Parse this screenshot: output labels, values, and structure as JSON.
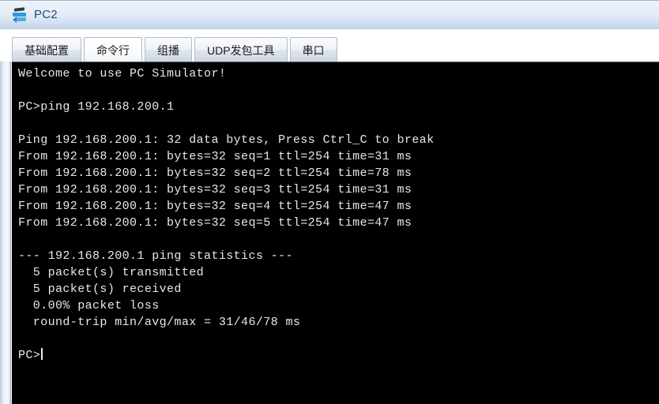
{
  "window": {
    "title": "PC2",
    "icon": "pc-network-icon"
  },
  "tabs": [
    {
      "label": "基础配置",
      "active": false
    },
    {
      "label": "命令行",
      "active": true
    },
    {
      "label": "组播",
      "active": false
    },
    {
      "label": "UDP发包工具",
      "active": false
    },
    {
      "label": "串口",
      "active": false
    }
  ],
  "terminal": {
    "prompt": "PC>",
    "lines": [
      "Welcome to use PC Simulator!",
      "",
      "PC>ping 192.168.200.1",
      "",
      "Ping 192.168.200.1: 32 data bytes, Press Ctrl_C to break",
      "From 192.168.200.1: bytes=32 seq=1 ttl=254 time=31 ms",
      "From 192.168.200.1: bytes=32 seq=2 ttl=254 time=78 ms",
      "From 192.168.200.1: bytes=32 seq=3 ttl=254 time=31 ms",
      "From 192.168.200.1: bytes=32 seq=4 ttl=254 time=47 ms",
      "From 192.168.200.1: bytes=32 seq=5 ttl=254 time=47 ms",
      "",
      "--- 192.168.200.1 ping statistics ---",
      "  5 packet(s) transmitted",
      "  5 packet(s) received",
      "  0.00% packet loss",
      "  round-trip min/avg/max = 31/46/78 ms",
      ""
    ],
    "last_prompt": "PC>"
  }
}
